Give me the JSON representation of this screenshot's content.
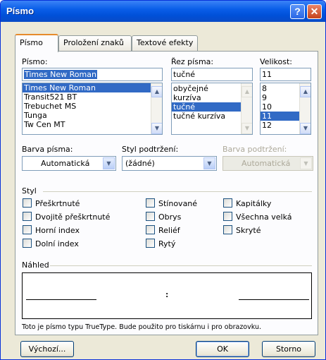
{
  "window": {
    "title": "Písmo",
    "help_label": "?",
    "close_label": "✕"
  },
  "tabs": [
    {
      "label": "Písmo",
      "active": true
    },
    {
      "label": "Proložení znaků",
      "active": false
    },
    {
      "label": "Textové efekty",
      "active": false
    }
  ],
  "font": {
    "label": "Písmo:",
    "value": "Times New Roman",
    "items": [
      "Times New Roman",
      "Transit521 BT",
      "Trebuchet MS",
      "Tunga",
      "Tw Cen MT"
    ],
    "selected": "Times New Roman"
  },
  "style": {
    "label": "Řez písma:",
    "value": "tučné",
    "items": [
      "obyčejné",
      "kurzíva",
      "tučné",
      "tučné kurzíva"
    ],
    "selected": "tučné"
  },
  "size": {
    "label": "Velikost:",
    "value": "11",
    "items": [
      "8",
      "9",
      "10",
      "11",
      "12"
    ],
    "selected": "11"
  },
  "font_color": {
    "label": "Barva písma:",
    "value": "Automatická"
  },
  "underline_style": {
    "label": "Styl podtržení:",
    "value": "(žádné)"
  },
  "underline_color": {
    "label": "Barva podtržení:",
    "value": "Automatická",
    "disabled": true
  },
  "effects": {
    "group_label": "Styl",
    "col1": [
      "Přeškrtnuté",
      "Dvojitě přeškrtnuté",
      "Horní index",
      "Dolní index"
    ],
    "col2": [
      "Stínované",
      "Obrys",
      "Reliéf",
      "Rytý"
    ],
    "col3": [
      "Kapitálky",
      "Všechna velká",
      "Skryté"
    ]
  },
  "preview": {
    "group_label": "Náhled",
    "text": ":",
    "note": "Toto je písmo typu TrueType. Bude použito pro tiskárnu i pro obrazovku."
  },
  "buttons": {
    "default_label": "Výchozí...",
    "ok_label": "OK",
    "cancel_label": "Storno"
  },
  "icons": {
    "scroll_up": "▲",
    "scroll_down": "▼",
    "dropdown": "▼"
  },
  "colors": {
    "selection": "#316ac5",
    "title_bar": "#0a5ee8",
    "dialog_bg": "#ece9d8"
  }
}
